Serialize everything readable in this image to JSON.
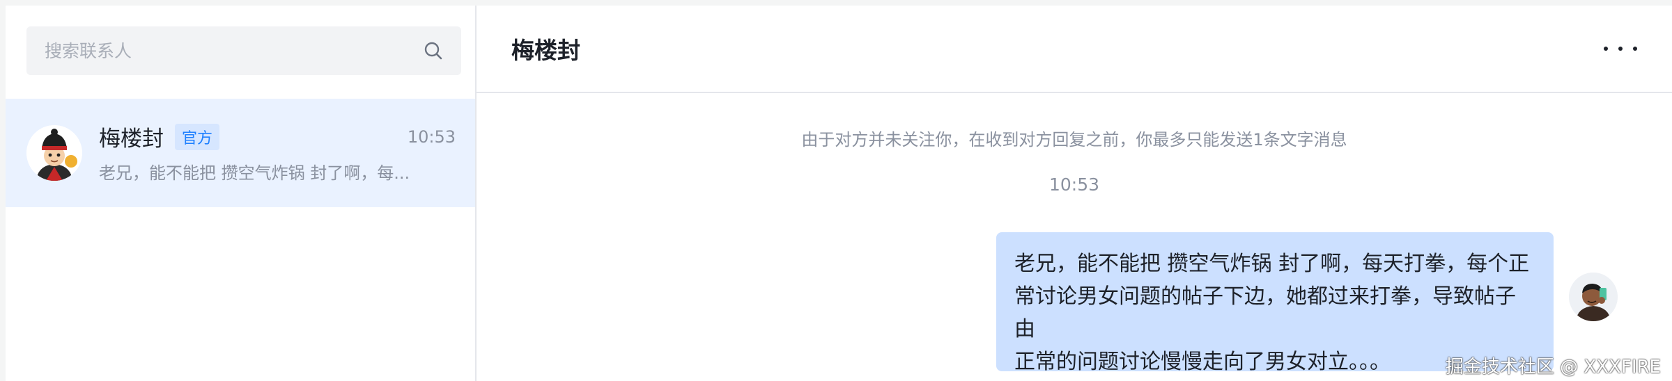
{
  "search": {
    "placeholder": "搜索联系人",
    "icon": "search-icon"
  },
  "contacts": [
    {
      "name": "梅楼封",
      "badge": "官方",
      "time": "10:53",
      "preview": "老兄，能不能把 攒空气炸锅 封了啊，每...",
      "avatar": "cartoon-avatar",
      "selected": true
    }
  ],
  "chat": {
    "title": "梅楼封",
    "more_icon": "more-dots-icon",
    "notice": "由于对方并未关注你，在收到对方回复之前，你最多只能发送1条文字消息",
    "time": "10:53",
    "message_lines": [
      "老兄，能不能把 攒空气炸锅 封了啊，每天打拳，每个正",
      "常讨论男女问题的帖子下边，她都过来打拳，导致帖子由",
      "正常的问题讨论慢慢走向了男女对立。。。"
    ]
  },
  "watermark": "掘金技术社区 @ XXXFIRE",
  "colors": {
    "accent": "#1e80ff",
    "selected_bg": "#eaf2ff",
    "bubble_bg": "#cce0ff",
    "muted_text": "#8a919f"
  }
}
